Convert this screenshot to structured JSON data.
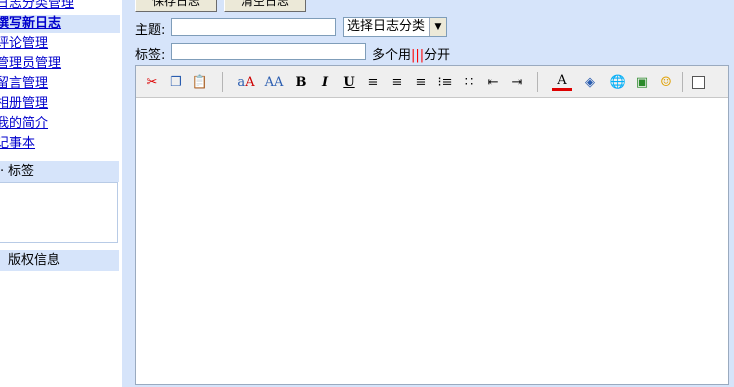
{
  "sidebar": {
    "items": [
      {
        "label": "日志分类管理",
        "active": false
      },
      {
        "label": "撰写新日志",
        "active": true
      },
      {
        "label": "评论管理",
        "active": false
      },
      {
        "label": "管理员管理",
        "active": false
      },
      {
        "label": "留言管理",
        "active": false
      },
      {
        "label": "相册管理",
        "active": false
      },
      {
        "label": "我的简介",
        "active": false
      },
      {
        "label": "记事本",
        "active": false
      }
    ],
    "tags_panel_title": "标签",
    "copyright_panel_title": "版权信息"
  },
  "form": {
    "save_button": "保存日志",
    "clear_button": "清空日志",
    "subject_label": "主题:",
    "subject_value": "",
    "category_select": "选择日志分类",
    "tags_label": "标签:",
    "tags_value": "",
    "tags_hint_prefix": "多个用",
    "tags_hint_sep": "|||",
    "tags_hint_suffix": "分开"
  },
  "toolbar": {
    "buttons": [
      "cut-icon",
      "copy-icon",
      "paste-icon",
      "font-icon",
      "font-size-icon",
      "bold-icon",
      "italic-icon",
      "underline-icon",
      "align-left-icon",
      "align-center-icon",
      "align-right-icon",
      "ordered-list-icon",
      "unordered-list-icon",
      "outdent-icon",
      "indent-icon",
      "text-color-icon",
      "highlight-icon",
      "link-icon",
      "image-icon",
      "emoticon-icon",
      "checkbox-icon"
    ]
  },
  "colors": {
    "panel_bg": "#d6e4fa",
    "link": "#0000cc",
    "accent_red": "#ff0000"
  }
}
